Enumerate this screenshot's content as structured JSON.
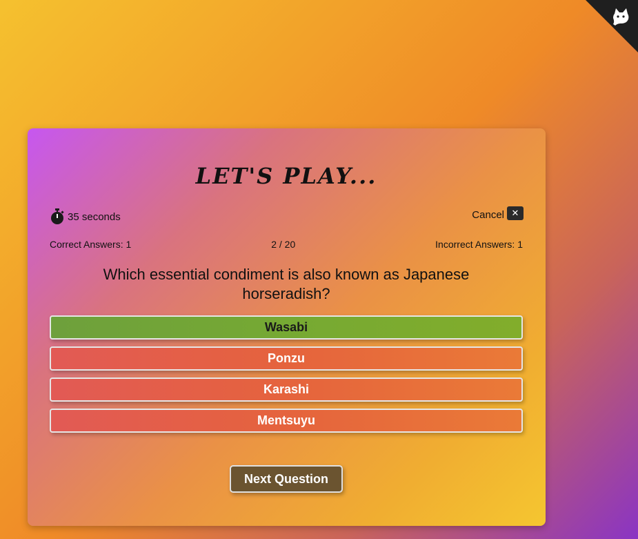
{
  "corner": {
    "icon": "cat-icon",
    "color": "#1f1f1f"
  },
  "quiz": {
    "title": "LET'S PLAY...",
    "timer": {
      "icon": "stopwatch-icon",
      "text": "35 seconds"
    },
    "cancel": {
      "label": "Cancel",
      "icon": "close-icon",
      "glyph": "✕"
    },
    "stats": {
      "correct": "Correct Answers: 1",
      "progress": "2 / 20",
      "incorrect": "Incorrect Answers: 1"
    },
    "question": "Which essential condiment is also known as Japanese horseradish?",
    "answers": [
      {
        "label": "Wasabi",
        "state": "correct"
      },
      {
        "label": "Ponzu",
        "state": "incorrect"
      },
      {
        "label": "Karashi",
        "state": "incorrect"
      },
      {
        "label": "Mentsuyu",
        "state": "incorrect"
      }
    ],
    "next_label": "Next Question"
  },
  "colors": {
    "correct": "#76a933",
    "incorrect": "#e5633d",
    "next_button": "#6b5430"
  }
}
